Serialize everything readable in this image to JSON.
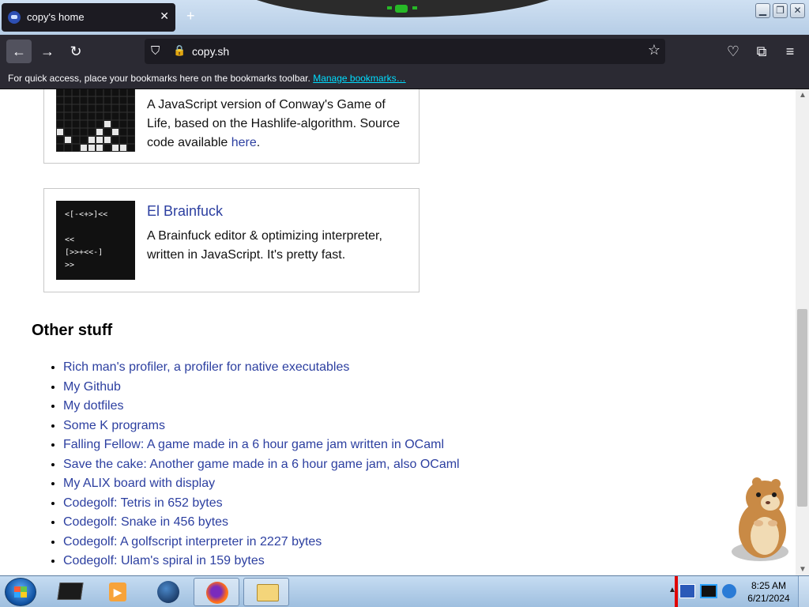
{
  "browser": {
    "tab_title": "copy's home",
    "tab_close": "✕",
    "new_tab": "+",
    "url": "copy.sh",
    "back_icon": "←",
    "forward_icon": "→",
    "reload_icon": "↻",
    "shield_icon": "⛉",
    "lock_icon": "🔒",
    "star_icon": "☆",
    "pocket_icon": "♡",
    "extensions_icon": "⧉",
    "menu_icon": "≡",
    "bookmarks_message": "For quick access, place your bookmarks here on the bookmarks toolbar.",
    "bookmarks_link": "Manage bookmarks…"
  },
  "window_controls": {
    "minimize": "▁",
    "maximize": "❐",
    "close": "✕"
  },
  "projects": {
    "life": {
      "desc_pre": "A JavaScript version of Conway's Game of Life, based on the Hashlife-algorithm. Source code available ",
      "desc_link": "here",
      "desc_post": "."
    },
    "brainfuck": {
      "title": "El Brainfuck",
      "desc": "A Brainfuck editor & optimizing interpreter, written in JavaScript. It's pretty fast.",
      "thumb_code": "<[-<+>]<<\n\n<<\n[>>+<<-]\n>>"
    }
  },
  "other": {
    "heading": "Other stuff",
    "items": [
      "Rich man's profiler, a profiler for native executables",
      "My Github",
      "My dotfiles",
      "Some K programs",
      "Falling Fellow: A game made in a 6 hour game jam written in OCaml",
      "Save the cake: Another game made in a 6 hour game jam, also OCaml",
      "My ALIX board with display",
      "Codegolf: Tetris in 652 bytes",
      "Codegolf: Snake in 456 bytes",
      "Codegolf: A golfscript interpreter in 2227 bytes",
      "Codegolf: Ulam's spiral in 159 bytes"
    ]
  },
  "taskbar": {
    "time": "8:25 AM",
    "date": "6/21/2024",
    "media_glyph": "▶"
  },
  "colors": {
    "link": "#2c3fa0",
    "toolbar": "#2b2a33",
    "bookmark_link": "#00ddff"
  }
}
